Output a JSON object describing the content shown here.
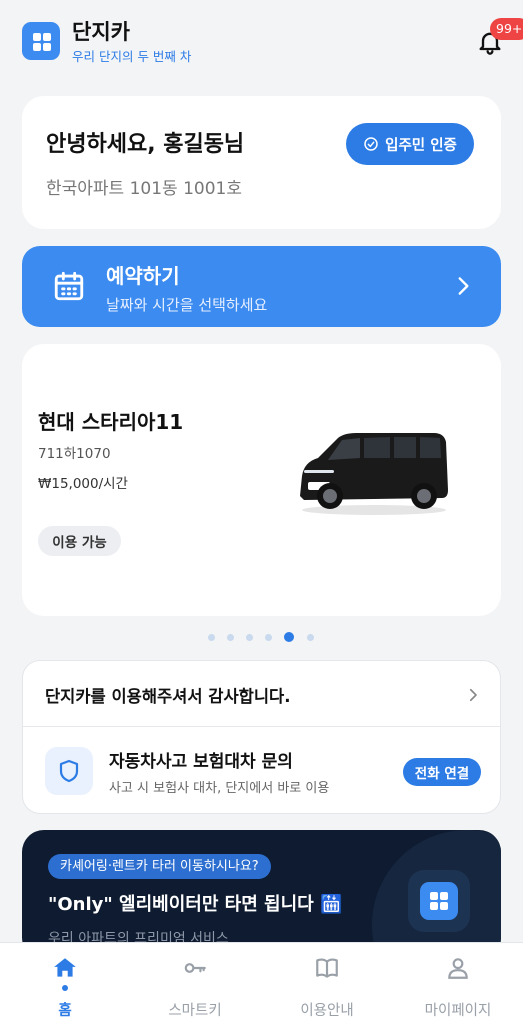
{
  "header": {
    "title": "단지카",
    "subtitle": "우리 단지의 두 번째 차",
    "notification_count": "99+"
  },
  "greeting": {
    "text": "안녕하세요, 홍길동님",
    "address": "한국아파트 101동 1001호",
    "verify_label": "입주민 인증"
  },
  "reservation": {
    "title": "예약하기",
    "subtitle": "날짜와 시간을 선택하세요"
  },
  "car": {
    "name": "현대 스타리아11",
    "plate": "711하1070",
    "price": "₩15,000/시간",
    "status": "이용 가능"
  },
  "carousel": {
    "total": 6,
    "active_index": 4
  },
  "info": {
    "thanks": "단지카를 이용해주셔서 감사합니다.",
    "insurance_title": "자동차사고 보험대차 문의",
    "insurance_sub": "사고 시 보험사 대차, 단지에서 바로 이용",
    "call_label": "전화 연결"
  },
  "promo": {
    "pill": "카셰어링·렌트카 타러 이동하시나요?",
    "title": "\"Only\" 엘리베이터만 타면 됩니다 🛗",
    "subtitle": "우리 아파트의 프리미엄 서비스"
  },
  "tabs": [
    {
      "label": "홈",
      "icon": "home-icon"
    },
    {
      "label": "스마트키",
      "icon": "key-icon"
    },
    {
      "label": "이용안내",
      "icon": "book-icon"
    },
    {
      "label": "마이페이지",
      "icon": "user-icon"
    }
  ],
  "colors": {
    "accent": "#2d7ce6",
    "reserve_bg": "#3b8bf0",
    "promo_bg": "#0e1b30",
    "badge": "#ef4444"
  }
}
